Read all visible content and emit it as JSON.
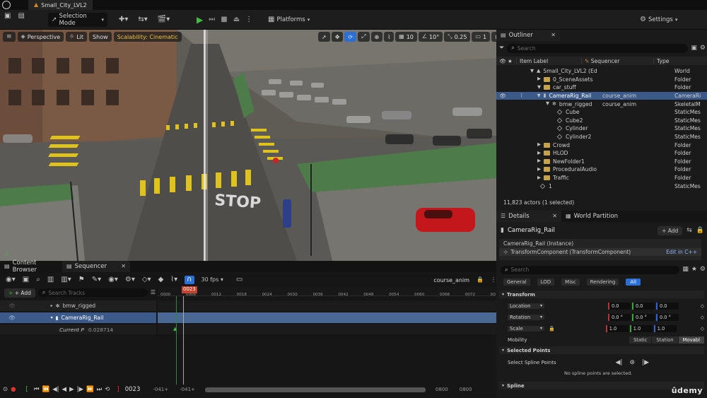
{
  "title_bar": {
    "project_name": "Small_City_LVL2"
  },
  "toolbar": {
    "selection_mode": "Selection Mode",
    "platforms": "Platforms",
    "settings": "Settings"
  },
  "viewport": {
    "perspective": "Perspective",
    "lit": "Lit",
    "show": "Show",
    "scalability": "Scalability: Cinematic",
    "grid_snap": "10",
    "rot_snap": "10°",
    "scale_snap": "0.25",
    "cam_speed": "1",
    "stop_text": "STOP"
  },
  "outliner": {
    "tab": "Outliner",
    "search_placeholder": "Search",
    "col_label": "Item Label",
    "col_sequencer": "Sequencer",
    "col_type": "Type",
    "rows": [
      {
        "label": "Small_City_LVL2 (Ed",
        "seq": "",
        "type": "World"
      },
      {
        "label": "0_SceneAssets",
        "seq": "",
        "type": "Folder"
      },
      {
        "label": "car_stuff",
        "seq": "",
        "type": "Folder"
      },
      {
        "label": "CameraRig_Rail",
        "seq": "course_anim",
        "type": "CameraRi"
      },
      {
        "label": "bmw_rigged",
        "seq": "course_anim",
        "type": "SkeletalM"
      },
      {
        "label": "Cube",
        "seq": "",
        "type": "StaticMes"
      },
      {
        "label": "Cube2",
        "seq": "",
        "type": "StaticMes"
      },
      {
        "label": "Cylinder",
        "seq": "",
        "type": "StaticMes"
      },
      {
        "label": "Cylinder2",
        "seq": "",
        "type": "StaticMes"
      },
      {
        "label": "Crowd",
        "seq": "",
        "type": "Folder"
      },
      {
        "label": "HLOD",
        "seq": "",
        "type": "Folder"
      },
      {
        "label": "NewFolder1",
        "seq": "",
        "type": "Folder"
      },
      {
        "label": "ProceduralAudio",
        "seq": "",
        "type": "Folder"
      },
      {
        "label": "Traffic",
        "seq": "",
        "type": "Folder"
      },
      {
        "label": "1",
        "seq": "",
        "type": "StaticMes"
      }
    ],
    "status": "11,823 actors (1 selected)"
  },
  "details": {
    "tab": "Details",
    "tab2": "World Partition",
    "actor_name": "CameraRig_Rail",
    "add": "+ Add",
    "instance": "CameraRig_Rail (Instance)",
    "component": "TransformComponent (TransformComponent)",
    "edit_cpp": "Edit in C++",
    "search_placeholder": "Search",
    "filters": [
      "General",
      "LOD",
      "Misc",
      "Rendering",
      "All"
    ],
    "transform_header": "Transform",
    "location": "Location",
    "rotation": "Rotation",
    "scale": "Scale",
    "loc_vals": [
      "0.0",
      "0.0",
      "0.0"
    ],
    "rot_vals": [
      "0.0 °",
      "0.0 °",
      "0.0 °"
    ],
    "scale_vals": [
      "1.0",
      "1.0",
      "1.0"
    ],
    "mobility": "Mobility",
    "mob_opts": [
      "Static",
      "Station",
      "Movabl"
    ],
    "selected_points": "Selected Points",
    "select_spline_points": "Select Spline Points",
    "no_spline": "No spline points are selected.",
    "spline": "Spline"
  },
  "sequencer": {
    "tab1": "Content Browser",
    "tab2": "Sequencer",
    "fps": "30 fps",
    "seq_name": "course_anim",
    "add": "+ Add",
    "search_placeholder": "Search Tracks",
    "tracks": [
      {
        "name": "bmw_rigged"
      },
      {
        "name": "CameraRig_Rail"
      }
    ],
    "current_label": "Current P",
    "current_value": "0.028714",
    "playhead": "0023",
    "ticks": [
      "0000",
      "0006",
      "0012",
      "0018",
      "0024",
      "0030",
      "0036",
      "0042",
      "0048",
      "0054",
      "0060",
      "0066",
      "0072",
      "00"
    ],
    "frame_display": "0023",
    "range_start": "-041+",
    "range_start2": "-041+",
    "range_end": "0800",
    "range_end2": "0800"
  },
  "watermark": "ûdemy"
}
